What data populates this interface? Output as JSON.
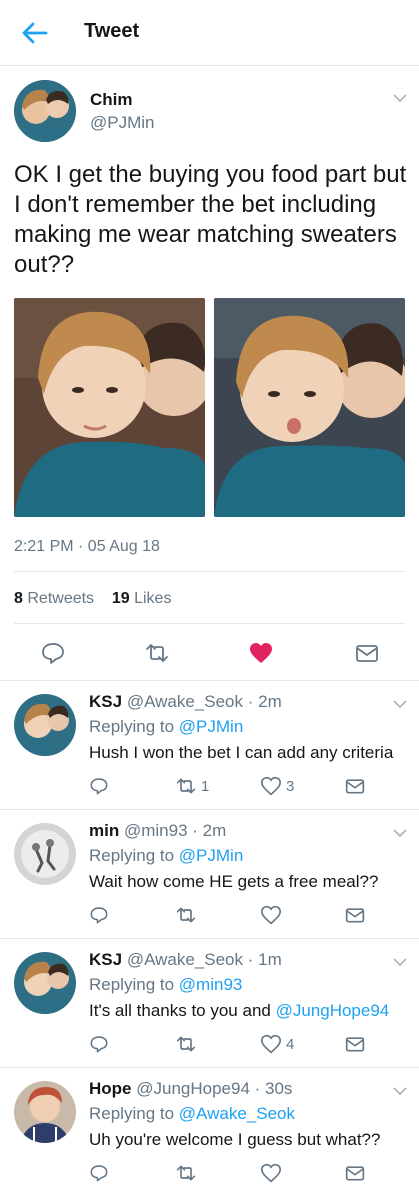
{
  "header": {
    "title": "Tweet"
  },
  "tweet": {
    "name": "Chim",
    "handle": "@PJMin",
    "text": "OK I get the buying you food part but I don't remember the bet including making me wear matching sweaters out??",
    "timestamp": "2:21 PM · 05 Aug 18",
    "retweets_count": "8",
    "retweets_label": "Retweets",
    "likes_count": "19",
    "likes_label": "Likes",
    "liked": true
  },
  "replies": [
    {
      "name": "KSJ",
      "handle": "@Awake_Seok",
      "time": "· 2m",
      "replying_label": "Replying to",
      "replying_to": "@PJMin",
      "text": "Hush I won the bet I can add any criteria",
      "text_mention": "",
      "retweets": "1",
      "likes": "3"
    },
    {
      "name": "min",
      "handle": "@min93",
      "time": "· 2m",
      "replying_label": "Replying to",
      "replying_to": "@PJMin",
      "text": "Wait how come HE gets a free meal??",
      "text_mention": "",
      "retweets": "",
      "likes": ""
    },
    {
      "name": "KSJ",
      "handle": "@Awake_Seok",
      "time": "· 1m",
      "replying_label": "Replying to",
      "replying_to": "@min93",
      "text": "It's all thanks to you and ",
      "text_mention": "@JungHope94",
      "retweets": "",
      "likes": "4"
    },
    {
      "name": "Hope",
      "handle": "@JungHope94",
      "time": "· 30s",
      "replying_label": "Replying to",
      "replying_to": "@Awake_Seok",
      "text": "Uh you're welcome I guess but what??",
      "text_mention": "",
      "retweets": "",
      "likes": ""
    }
  ],
  "colors": {
    "accent": "#1da1f2",
    "like": "#e0245e",
    "secondary": "#657786",
    "border": "#e1e8ed"
  },
  "icons": [
    "back-arrow-icon",
    "chevron-down-icon",
    "reply-icon",
    "retweet-icon",
    "like-icon",
    "message-icon"
  ]
}
